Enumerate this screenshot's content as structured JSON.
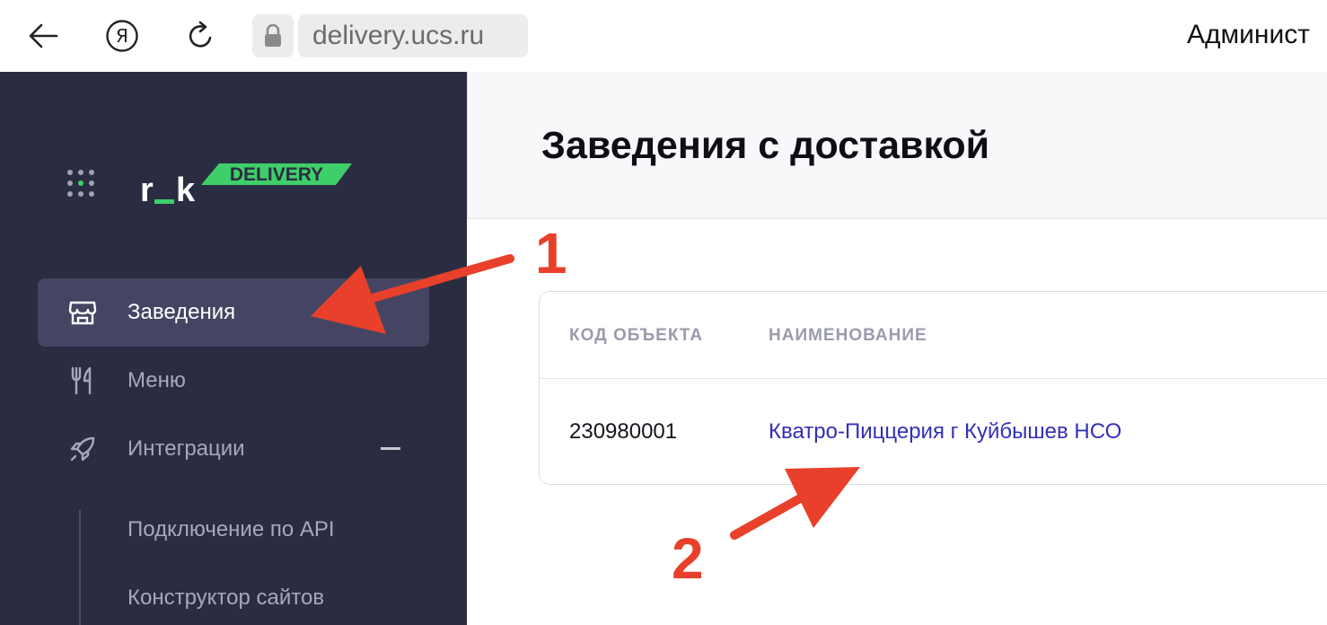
{
  "browser": {
    "url": "delivery.ucs.ru",
    "user_label": "Админист"
  },
  "sidebar": {
    "logo_text": "r_k",
    "logo_badge": "DELIVERY",
    "items": [
      {
        "label": "Заведения",
        "icon": "store-icon",
        "active": true
      },
      {
        "label": "Меню",
        "icon": "fork-knife-icon",
        "active": false
      },
      {
        "label": "Интеграции",
        "icon": "rocket-icon",
        "active": false
      }
    ],
    "sub_items": [
      {
        "label": "Подключение по API"
      },
      {
        "label": "Конструктор сайтов"
      }
    ]
  },
  "main": {
    "title": "Заведения с доставкой",
    "table": {
      "columns": [
        "КОД ОБЪЕКТА",
        "НАИМЕНОВАНИЕ"
      ],
      "rows": [
        {
          "code": "230980001",
          "name": "Кватро-Пиццерия г Куйбышев НСО"
        }
      ]
    }
  },
  "annotations": {
    "marker_1": "1",
    "marker_2": "2",
    "color": "#e8402a"
  },
  "colors": {
    "sidebar_bg": "#2a2d42",
    "active_item_bg": "#454563",
    "brand_green": "#3ecf6a",
    "link": "#3230b8"
  }
}
